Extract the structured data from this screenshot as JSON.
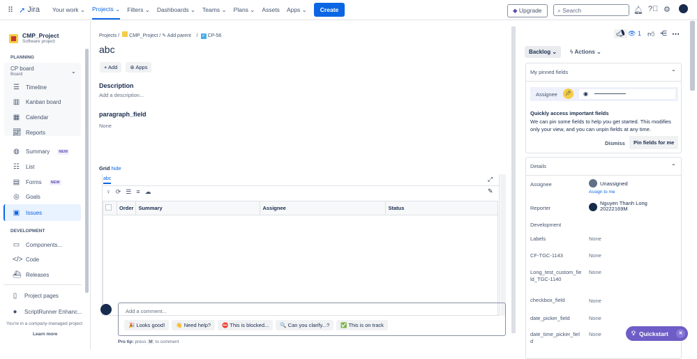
{
  "topnav": {
    "logo": "Jira",
    "items": [
      "Your work",
      "Projects",
      "Filters",
      "Dashboards",
      "Teams",
      "Plans",
      "Assets",
      "Apps"
    ],
    "create": "Create",
    "upgrade": "Upgrade",
    "search_placeholder": "Search"
  },
  "sidebar": {
    "project_name": "CMP_Project",
    "project_type": "Software project",
    "planning": "PLANNING",
    "board_name": "CP board",
    "board_sub": "Board",
    "board_items": [
      "Timeline",
      "Kanban board",
      "Calendar",
      "Reports"
    ],
    "items": [
      {
        "label": "Summary",
        "badge": "NEW"
      },
      {
        "label": "List"
      },
      {
        "label": "Forms",
        "badge": "NEW"
      },
      {
        "label": "Goals"
      },
      {
        "label": "Issues"
      }
    ],
    "development": "DEVELOPMENT",
    "dev_items": [
      "Components...",
      "Code",
      "Releases"
    ],
    "extra_items": [
      "Project pages",
      "ScriptRunner Enhanc..."
    ],
    "footer": "You're in a company-managed project",
    "learn_more": "Learn more"
  },
  "breadcrumb": {
    "projects": "Projects",
    "project": "CMP_Project",
    "add_parent": "Add parent",
    "issue_key": "CP-56"
  },
  "issue": {
    "title": "abc",
    "add": "+ Add",
    "apps": "Apps",
    "description_label": "Description",
    "description_placeholder": "Add a description...",
    "paragraph_label": "paragraph_field",
    "paragraph_value": "None"
  },
  "grid": {
    "label": "Grid",
    "hide": "hide",
    "tab": "abc",
    "columns": [
      "Order",
      "Summary",
      "Assignee",
      "Status"
    ]
  },
  "comment": {
    "placeholder": "Add a comment...",
    "suggestions": [
      "🎉 Looks good!",
      "👋 Need help?",
      "⛔ This is blocked...",
      "🔍 Can you clarify...?",
      "✅ This is on track"
    ],
    "tip_prefix": "Pro tip:",
    "tip_press": "press",
    "tip_key": "M",
    "tip_suffix": "to comment"
  },
  "right": {
    "watchers": "1",
    "status": "Backlog",
    "actions": "Actions",
    "pinned": {
      "title": "My pinned fields",
      "field": "Assignee",
      "heading": "Quickly access important fields",
      "body": "We can pin some fields to help you get started. This modifies only your view, and you can unpin fields at any time.",
      "dismiss": "Dismiss",
      "pin": "Pin fields for me"
    },
    "details": {
      "title": "Details",
      "assignee_label": "Assignee",
      "assignee": "Unassigned",
      "assign_to_me": "Assign to me",
      "reporter_label": "Reporter",
      "reporter": "Nguyen Thanh Long 20222169M",
      "development_label": "Development",
      "fields": [
        {
          "label": "Labels",
          "value": "None"
        },
        {
          "label": "CF-TGC-1143",
          "value": "None"
        },
        {
          "label": "Long_test_custom_field_TGC-1140",
          "value": "None"
        },
        {
          "label": "checkbox_field",
          "value": "None"
        },
        {
          "label": "date_picker_field",
          "value": "None"
        },
        {
          "label": "date_time_picker_field",
          "value": "None"
        }
      ]
    }
  },
  "quickstart": "Quickstart"
}
